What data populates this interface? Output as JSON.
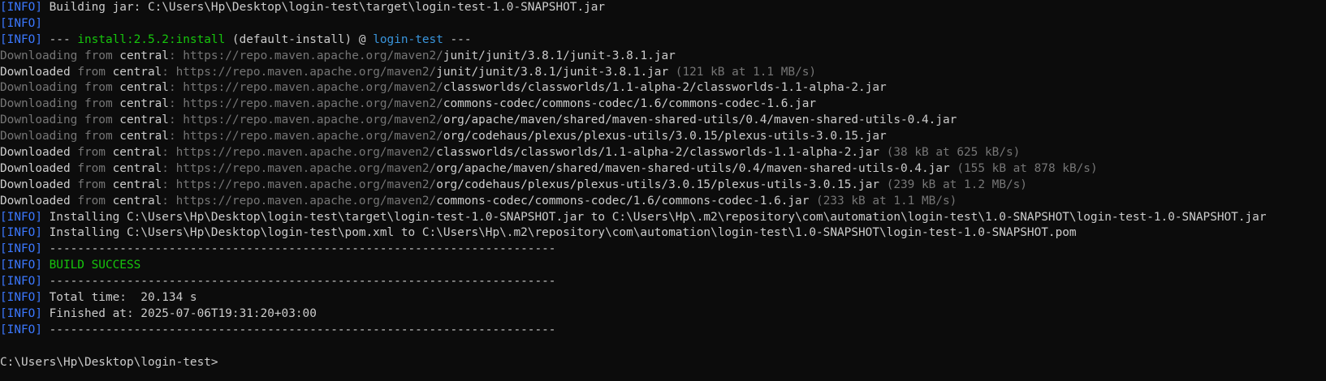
{
  "terminal": {
    "lines": [
      [
        [
          "blue",
          "[INFO]"
        ],
        [
          "white",
          " Building jar: C:\\Users\\Hp\\Desktop\\login-test\\target\\login-test-1.0-SNAPSHOT.jar"
        ]
      ],
      [
        [
          "blue",
          "[INFO]"
        ]
      ],
      [
        [
          "blue",
          "[INFO]"
        ],
        [
          "white",
          " --- "
        ],
        [
          "green",
          "install:2.5.2:install"
        ],
        [
          "white",
          " (default-install) @ "
        ],
        [
          "cyan",
          "login-test"
        ],
        [
          "white",
          " ---"
        ]
      ],
      [
        [
          "dim",
          "Downloading from "
        ],
        [
          "white",
          "central"
        ],
        [
          "dim",
          ": https://repo.maven.apache.org/maven2/"
        ],
        [
          "white",
          "junit/junit/3.8.1/junit-3.8.1.jar"
        ]
      ],
      [
        [
          "white",
          "Downloaded "
        ],
        [
          "dim",
          "from "
        ],
        [
          "white",
          "central"
        ],
        [
          "dim",
          ": https://repo.maven.apache.org/maven2/"
        ],
        [
          "white",
          "junit/junit/3.8.1/junit-3.8.1.jar"
        ],
        [
          "dim",
          " (121 kB at 1.1 MB/s)"
        ]
      ],
      [
        [
          "dim",
          "Downloading from "
        ],
        [
          "white",
          "central"
        ],
        [
          "dim",
          ": https://repo.maven.apache.org/maven2/"
        ],
        [
          "white",
          "classworlds/classworlds/1.1-alpha-2/classworlds-1.1-alpha-2.jar"
        ]
      ],
      [
        [
          "dim",
          "Downloading from "
        ],
        [
          "white",
          "central"
        ],
        [
          "dim",
          ": https://repo.maven.apache.org/maven2/"
        ],
        [
          "white",
          "commons-codec/commons-codec/1.6/commons-codec-1.6.jar"
        ]
      ],
      [
        [
          "dim",
          "Downloading from "
        ],
        [
          "white",
          "central"
        ],
        [
          "dim",
          ": https://repo.maven.apache.org/maven2/"
        ],
        [
          "white",
          "org/apache/maven/shared/maven-shared-utils/0.4/maven-shared-utils-0.4.jar"
        ]
      ],
      [
        [
          "dim",
          "Downloading from "
        ],
        [
          "white",
          "central"
        ],
        [
          "dim",
          ": https://repo.maven.apache.org/maven2/"
        ],
        [
          "white",
          "org/codehaus/plexus/plexus-utils/3.0.15/plexus-utils-3.0.15.jar"
        ]
      ],
      [
        [
          "white",
          "Downloaded "
        ],
        [
          "dim",
          "from "
        ],
        [
          "white",
          "central"
        ],
        [
          "dim",
          ": https://repo.maven.apache.org/maven2/"
        ],
        [
          "white",
          "classworlds/classworlds/1.1-alpha-2/classworlds-1.1-alpha-2.jar"
        ],
        [
          "dim",
          " (38 kB at 625 kB/s)"
        ]
      ],
      [
        [
          "white",
          "Downloaded "
        ],
        [
          "dim",
          "from "
        ],
        [
          "white",
          "central"
        ],
        [
          "dim",
          ": https://repo.maven.apache.org/maven2/"
        ],
        [
          "white",
          "org/apache/maven/shared/maven-shared-utils/0.4/maven-shared-utils-0.4.jar"
        ],
        [
          "dim",
          " (155 kB at 878 kB/s)"
        ]
      ],
      [
        [
          "white",
          "Downloaded "
        ],
        [
          "dim",
          "from "
        ],
        [
          "white",
          "central"
        ],
        [
          "dim",
          ": https://repo.maven.apache.org/maven2/"
        ],
        [
          "white",
          "org/codehaus/plexus/plexus-utils/3.0.15/plexus-utils-3.0.15.jar"
        ],
        [
          "dim",
          " (239 kB at 1.2 MB/s)"
        ]
      ],
      [
        [
          "white",
          "Downloaded "
        ],
        [
          "dim",
          "from "
        ],
        [
          "white",
          "central"
        ],
        [
          "dim",
          ": https://repo.maven.apache.org/maven2/"
        ],
        [
          "white",
          "commons-codec/commons-codec/1.6/commons-codec-1.6.jar"
        ],
        [
          "dim",
          " (233 kB at 1.1 MB/s)"
        ]
      ],
      [
        [
          "blue",
          "[INFO]"
        ],
        [
          "white",
          " Installing C:\\Users\\Hp\\Desktop\\login-test\\target\\login-test-1.0-SNAPSHOT.jar to C:\\Users\\Hp\\.m2\\repository\\com\\automation\\login-test\\1.0-SNAPSHOT\\login-test-1.0-SNAPSHOT.jar"
        ]
      ],
      [
        [
          "blue",
          "[INFO]"
        ],
        [
          "white",
          " Installing C:\\Users\\Hp\\Desktop\\login-test\\pom.xml to C:\\Users\\Hp\\.m2\\repository\\com\\automation\\login-test\\1.0-SNAPSHOT\\login-test-1.0-SNAPSHOT.pom"
        ]
      ],
      [
        [
          "blue",
          "[INFO]"
        ],
        [
          "white",
          " ------------------------------------------------------------------------"
        ]
      ],
      [
        [
          "blue",
          "[INFO]"
        ],
        [
          "green",
          " BUILD SUCCESS"
        ]
      ],
      [
        [
          "blue",
          "[INFO]"
        ],
        [
          "white",
          " ------------------------------------------------------------------------"
        ]
      ],
      [
        [
          "blue",
          "[INFO]"
        ],
        [
          "white",
          " Total time:  20.134 s"
        ]
      ],
      [
        [
          "blue",
          "[INFO]"
        ],
        [
          "white",
          " Finished at: 2025-07-06T19:31:20+03:00"
        ]
      ],
      [
        [
          "blue",
          "[INFO]"
        ],
        [
          "white",
          " ------------------------------------------------------------------------"
        ]
      ],
      [],
      [
        [
          "white",
          "C:\\Users\\Hp\\Desktop\\login-test>"
        ]
      ]
    ]
  }
}
